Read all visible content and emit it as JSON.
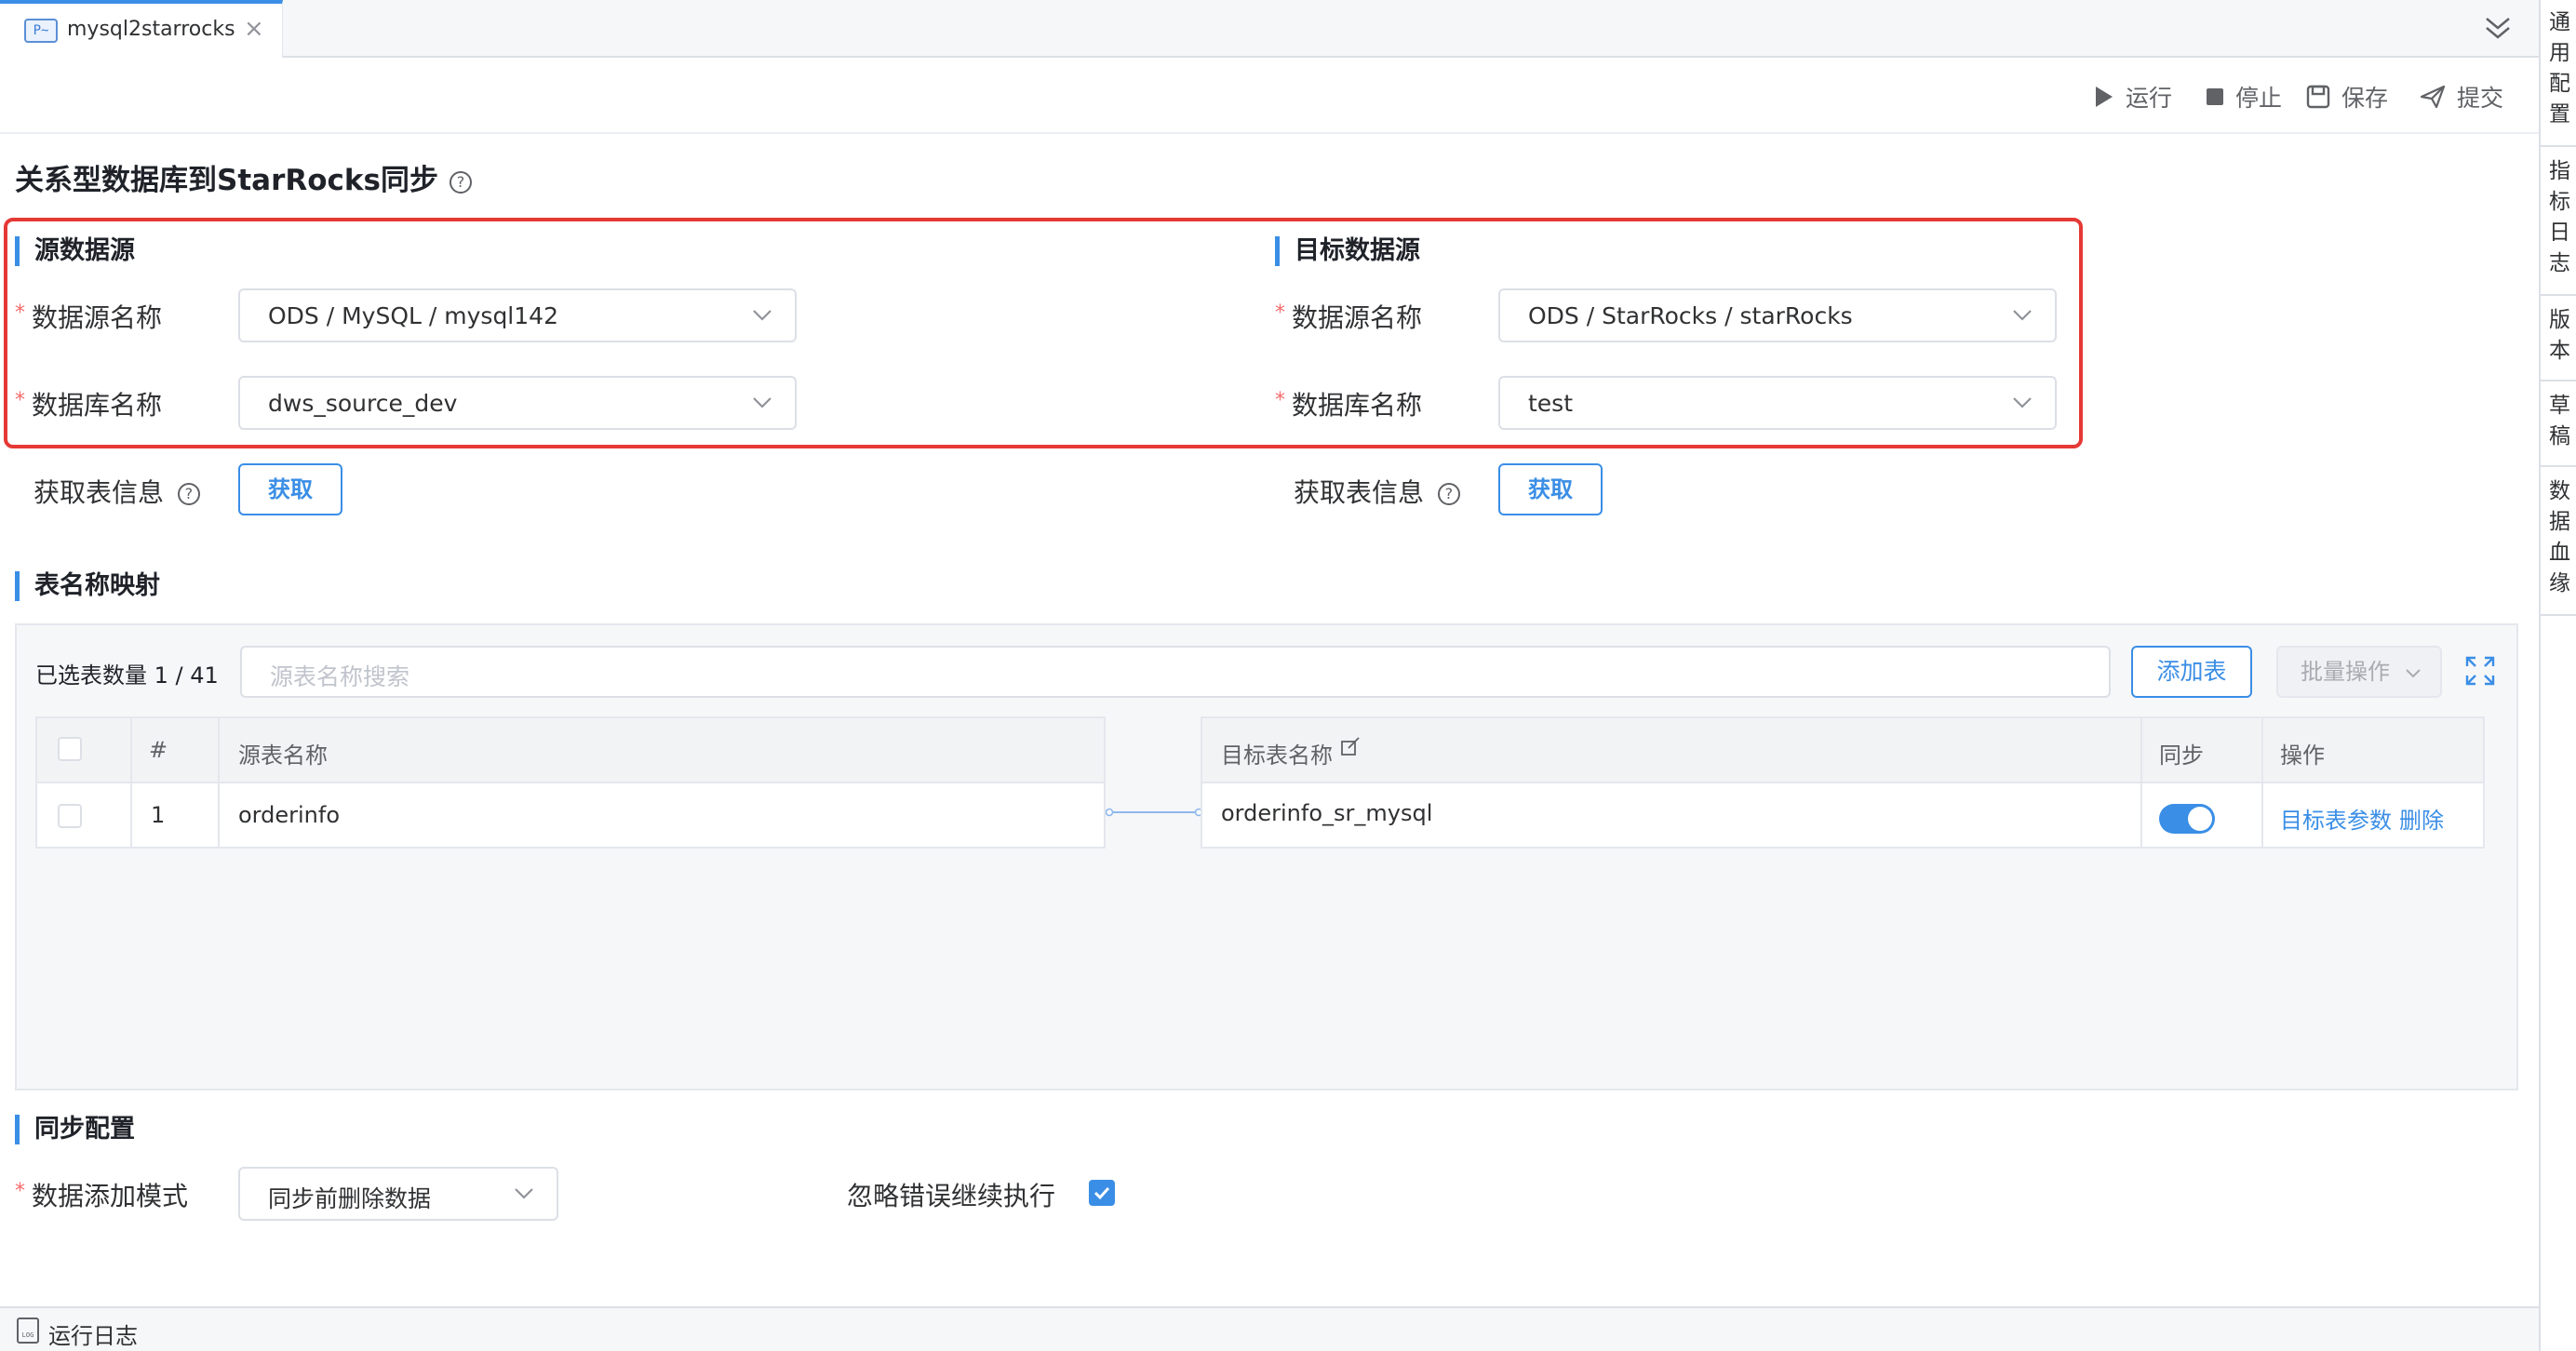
{
  "tab": {
    "title": "mysql2starrocks",
    "file_icon_text": "P~"
  },
  "side_panel": {
    "items": [
      "通用配置",
      "指标日志",
      "版本",
      "草稿",
      "数据血缘"
    ]
  },
  "toolbar": {
    "run": "运行",
    "stop": "停止",
    "save": "保存",
    "submit": "提交"
  },
  "page": {
    "title": "关系型数据库到StarRocks同步",
    "help_glyph": "?"
  },
  "source": {
    "title": "源数据源",
    "datasource_label": "数据源名称",
    "datasource_value": "ODS / MySQL / mysql142",
    "database_label": "数据库名称",
    "database_value": "dws_source_dev",
    "fetch_label": "获取表信息",
    "fetch_button": "获取"
  },
  "target": {
    "title": "目标数据源",
    "datasource_label": "数据源名称",
    "datasource_value": "ODS / StarRocks / starRocks",
    "database_label": "数据库名称",
    "database_value": "test",
    "fetch_label": "获取表信息",
    "fetch_button": "获取"
  },
  "mapping": {
    "title": "表名称映射",
    "selected_count": "已选表数量 1 / 41",
    "search_placeholder": "源表名称搜索",
    "add_button": "添加表",
    "batch_button": "批量操作",
    "columns": {
      "index": "#",
      "source_name": "源表名称",
      "target_name": "目标表名称",
      "sync": "同步",
      "actions": "操作"
    },
    "rows": [
      {
        "index": "1",
        "source_name": "orderinfo",
        "target_name": "orderinfo_sr_mysql",
        "sync": true,
        "action_params": "目标表参数",
        "action_delete": "删除"
      }
    ]
  },
  "sync_config": {
    "title": "同步配置",
    "mode_label": "数据添加模式",
    "mode_value": "同步前删除数据",
    "ignore_error_label": "忽略错误继续执行",
    "ignore_error_checked": true
  },
  "status_bar": {
    "log_label": "运行日志",
    "log_icon_text": "LOG"
  },
  "colors": {
    "accent": "#3a8ee6",
    "highlight_border": "#e53935",
    "required": "#f56c6c"
  }
}
